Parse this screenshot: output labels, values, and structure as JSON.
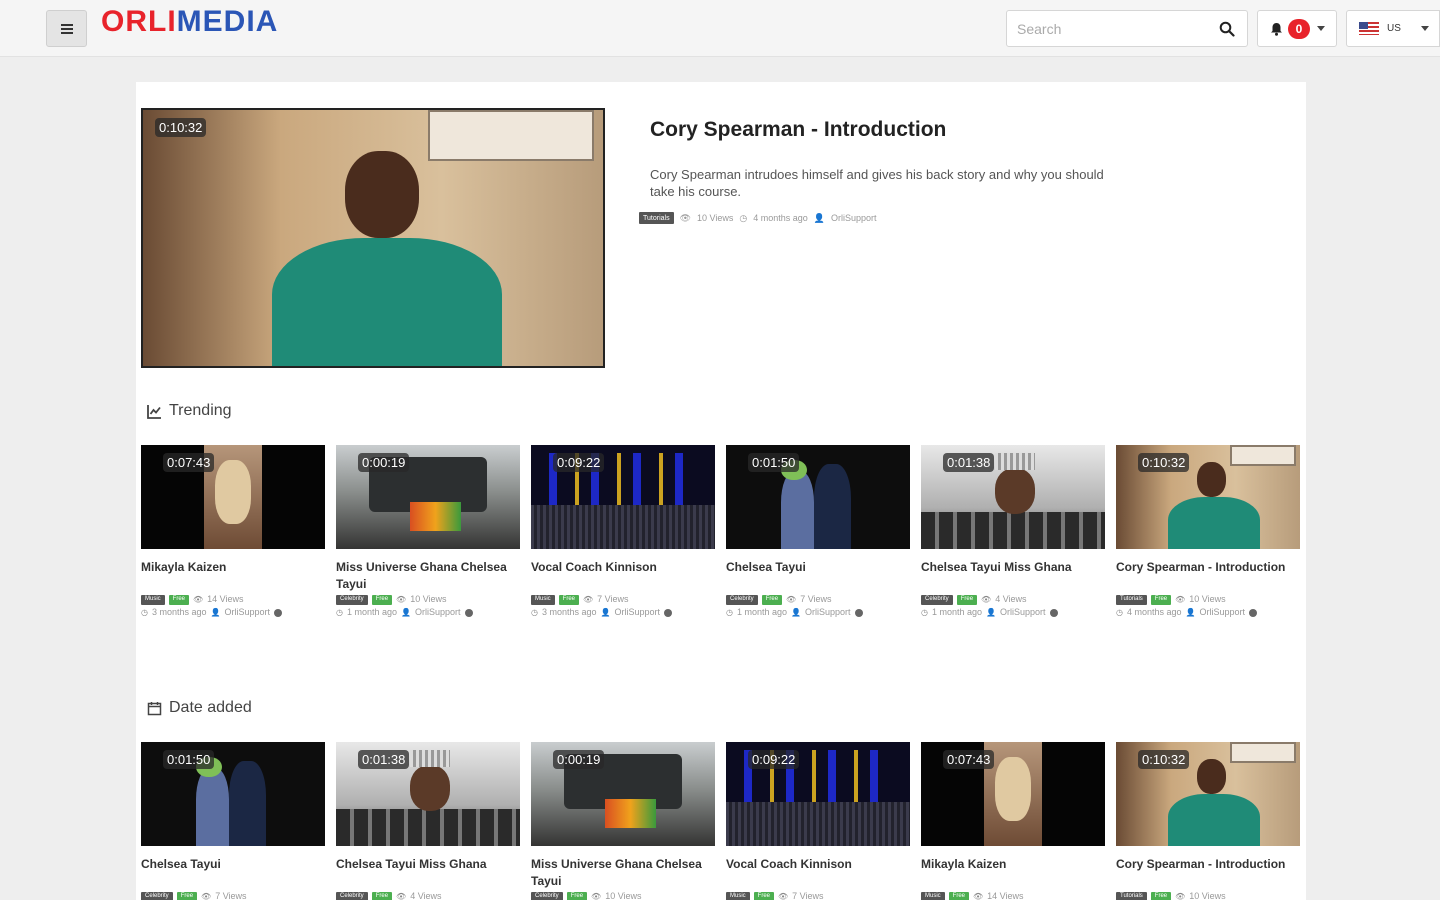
{
  "header": {
    "logo_part1": "ORLI",
    "logo_part2": "MEDIA",
    "search_placeholder": "Search",
    "notification_count": "0",
    "language": "US",
    "brand_red": "#e8232b",
    "brand_blue": "#2b56b6"
  },
  "featured": {
    "duration": "0:10:32",
    "title": "Cory Spearman - Introduction",
    "description": "Cory Spearman intrudoes himself and gives his back story and why you should take his course.",
    "category": "Tutorials",
    "views": "10 Views",
    "age": "4 months ago",
    "author": "OrliSupport"
  },
  "sections": {
    "trending": "Trending",
    "date_added": "Date added"
  },
  "trending": [
    {
      "duration": "0:07:43",
      "title": "Mikayla Kaizen",
      "category": "Music",
      "badge": "Free",
      "views": "14 Views",
      "age": "3 months ago",
      "author": "OrliSupport"
    },
    {
      "duration": "0:00:19",
      "title": "Miss Universe Ghana Chelsea Tayui",
      "category": "Celebrity",
      "badge": "Free",
      "views": "10 Views",
      "age": "1 month ago",
      "author": "OrliSupport"
    },
    {
      "duration": "0:09:22",
      "title": "Vocal Coach Kinnison",
      "category": "Music",
      "badge": "Free",
      "views": "7 Views",
      "age": "3 months ago",
      "author": "OrliSupport"
    },
    {
      "duration": "0:01:50",
      "title": "Chelsea Tayui",
      "category": "Celebrity",
      "badge": "Free",
      "views": "7 Views",
      "age": "1 month ago",
      "author": "OrliSupport"
    },
    {
      "duration": "0:01:38",
      "title": "Chelsea Tayui Miss Ghana",
      "category": "Celebrity",
      "badge": "Free",
      "views": "4 Views",
      "age": "1 month ago",
      "author": "OrliSupport"
    },
    {
      "duration": "0:10:32",
      "title": "Cory Spearman - Introduction",
      "category": "Tutorials",
      "badge": "Free",
      "views": "10 Views",
      "age": "4 months ago",
      "author": "OrliSupport"
    }
  ],
  "date_added": [
    {
      "duration": "0:01:50",
      "title": "Chelsea Tayui",
      "category": "Celebrity",
      "badge": "Free",
      "views": "7 Views"
    },
    {
      "duration": "0:01:38",
      "title": "Chelsea Tayui Miss Ghana",
      "category": "Celebrity",
      "badge": "Free",
      "views": "4 Views"
    },
    {
      "duration": "0:00:19",
      "title": "Miss Universe Ghana Chelsea Tayui",
      "category": "Celebrity",
      "badge": "Free",
      "views": "10 Views"
    },
    {
      "duration": "0:09:22",
      "title": "Vocal Coach Kinnison",
      "category": "Music",
      "badge": "Free",
      "views": "7 Views"
    },
    {
      "duration": "0:07:43",
      "title": "Mikayla Kaizen",
      "category": "Music",
      "badge": "Free",
      "views": "14 Views"
    },
    {
      "duration": "0:10:32",
      "title": "Cory Spearman - Introduction",
      "category": "Tutorials",
      "badge": "Free",
      "views": "10 Views"
    }
  ]
}
